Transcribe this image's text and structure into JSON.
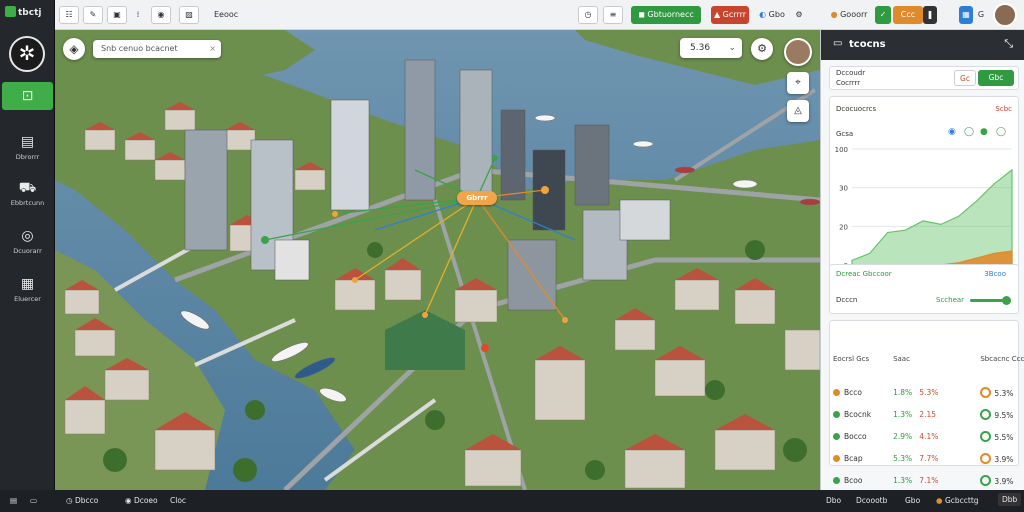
{
  "app": {
    "title": "tbctj"
  },
  "sidebar": {
    "active_icon": "map-icon",
    "items": [
      {
        "label": "Dbrorrr",
        "icon": "archive-icon"
      },
      {
        "label": "Ebbrtcunn",
        "icon": "truck-icon"
      },
      {
        "label": "Dcuorarr",
        "icon": "target-icon"
      },
      {
        "label": "Eluercer",
        "icon": "chart-icon"
      }
    ]
  },
  "toolbar": {
    "search_value": "Eeooc",
    "record_label": "Gbtuornecc",
    "alert_label": "Gcrrrr",
    "time_label": "Gbo",
    "status_label": "Gooorr",
    "tag_label": "Ccc",
    "ctrl_label": "G"
  },
  "map": {
    "search_value": "Snb cenuo bcacnet",
    "time_value": "5.36",
    "hub_label": "Gbrrr"
  },
  "panel": {
    "title": "tcocns",
    "header_label_1": "Dccoudr",
    "header_label_2": "Cocrrrr",
    "toggle_off": "Gc",
    "toggle_on": "Gbc",
    "section_label": "Dcocuocrcs",
    "section_value": "Scbc",
    "chart_legend": "Gcsa",
    "filter_label": "Dcreac Gbccoor",
    "filter_value": "3Bcoo",
    "slider_label": "Dcccn",
    "slider_value": "Scchear",
    "table_headers": [
      "Eocrsl Gcs",
      "Saac",
      "Sbcacnc Ccc Sarcrr"
    ],
    "rows": [
      {
        "name": "Bcco",
        "v1": "1.8%",
        "v2": "5.3%",
        "v3": "5.3%",
        "color": "#e08a2b"
      },
      {
        "name": "Bcocnk",
        "v1": "1.3%",
        "v2": "2.15",
        "v3": "9.5%",
        "color": "#3aa24a"
      },
      {
        "name": "Bocco",
        "v1": "2.9%",
        "v2": "4.1%",
        "v3": "5.5%",
        "color": "#3aa24a"
      },
      {
        "name": "Bcap",
        "v1": "5.3%",
        "v2": "7.7%",
        "v3": "3.9%",
        "color": "#e08a2b"
      },
      {
        "name": "Bcoo",
        "v1": "1.3%",
        "v2": "7.1%",
        "v3": "3.9%",
        "color": "#3aa24a"
      }
    ]
  },
  "chart_data": {
    "type": "area",
    "x": [
      "1",
      "3",
      "3",
      "3",
      "3",
      "3",
      "3",
      "3",
      "3",
      "3"
    ],
    "ylim": [
      0,
      100
    ],
    "yticks": [
      "0",
      "20",
      "30",
      "100"
    ],
    "series": [
      {
        "values": [
          4,
          10,
          28,
          30,
          38,
          35,
          42,
          55,
          70,
          82
        ],
        "color": "#66c36b"
      },
      {
        "values": [
          0,
          0,
          0,
          0,
          0,
          0,
          2,
          6,
          10,
          12
        ],
        "color": "#e08a2b"
      }
    ]
  },
  "bottombar": {
    "items": [
      "Dbcco",
      "Dcoeo",
      "Cloc"
    ],
    "right_items": [
      "Dbo",
      "Dcoootb",
      "Gbo",
      "Gcbccttg"
    ],
    "badge": "Dbb"
  }
}
